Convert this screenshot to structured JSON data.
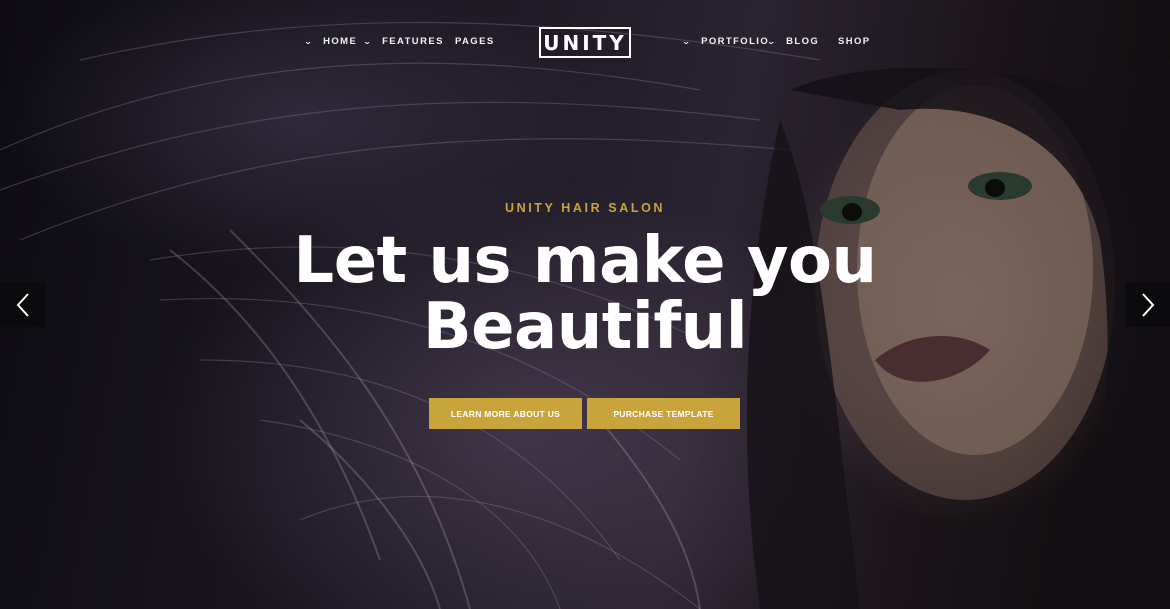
{
  "nav": {
    "left_items": [
      {
        "label": "HOME",
        "has_dropdown": true
      },
      {
        "label": "FEATURES",
        "has_dropdown": true
      },
      {
        "label": "PAGES",
        "has_dropdown": false
      }
    ],
    "logo": "UNITY",
    "right_items": [
      {
        "label": "PORTFOLIO",
        "has_dropdown": true
      },
      {
        "label": "BLOG",
        "has_dropdown": true
      },
      {
        "label": "SHOP",
        "has_dropdown": false
      }
    ],
    "dropdown_icon": "chevron-down-icon"
  },
  "hero": {
    "kicker": "UNITY HAIR SALON",
    "headline_line1": "Let us make you",
    "headline_line2": "Beautiful",
    "buttons": {
      "learn_more": "LEARN MORE ABOUT US",
      "purchase": "PURCHASE TEMPLATE"
    },
    "prev_icon": "chevron-left-icon",
    "next_icon": "chevron-right-icon"
  },
  "colors": {
    "accent": "#c9a43c",
    "nav_text": "#f2f2f2",
    "arrow_bg": "#0b0a0d"
  }
}
